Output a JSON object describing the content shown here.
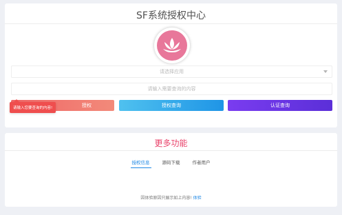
{
  "header": {
    "title": "SF系统授权中心"
  },
  "logo": {
    "icon": "lotus-icon",
    "color": "#e8779a"
  },
  "form": {
    "select_placeholder": "请选择应用",
    "query_placeholder": "请输入需要查询的内容"
  },
  "tooltip": {
    "text": "请输入您要查询的内容!"
  },
  "buttons": {
    "auth_label": "授权",
    "query_label": "授权查询",
    "verify_label": "认证查询"
  },
  "more": {
    "title": "更多功能",
    "tabs": [
      {
        "label": "授权信息",
        "active": true
      },
      {
        "label": "源码下载",
        "active": false
      },
      {
        "label": "作者用户",
        "active": false
      }
    ],
    "notice_text": "因体验原因只展示如上内容!",
    "notice_link": "体验"
  },
  "colors": {
    "accent_pink": "#e9436b",
    "button_auth": "#f06767",
    "button_query": "#1f95e6",
    "button_verify": "#5b2fd8",
    "tooltip": "#ef4e4e"
  }
}
